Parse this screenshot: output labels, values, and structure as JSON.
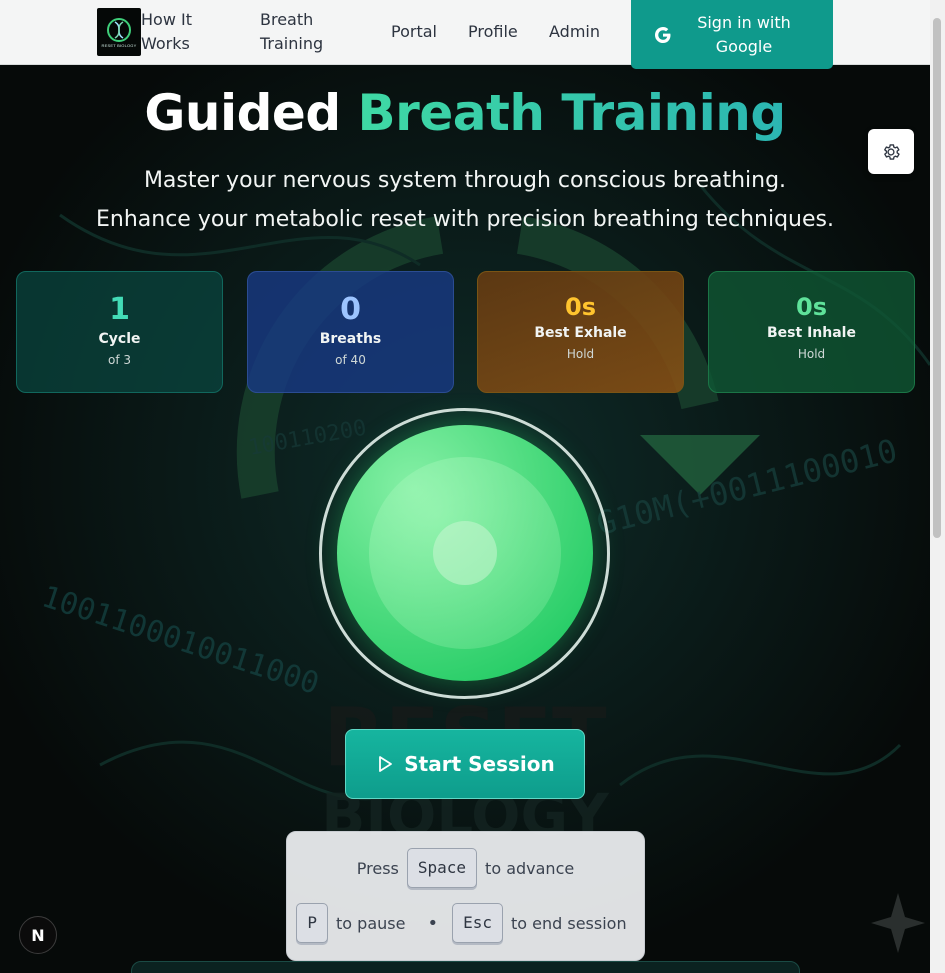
{
  "nav": {
    "logo_text": "RESET BIOLOGY",
    "links": [
      "How It Works",
      "Breath Training",
      "Portal",
      "Profile",
      "Admin"
    ],
    "signin_label": "Sign in with Google"
  },
  "hero": {
    "title_plain": "Guided",
    "title_accent": "Breath Training",
    "subtitle_1": "Master your nervous system through conscious breathing.",
    "subtitle_2": "Enhance your metabolic reset with precision breathing techniques."
  },
  "stats": [
    {
      "value": "1",
      "label": "Cycle",
      "sub": "of 3"
    },
    {
      "value": "0",
      "label": "Breaths",
      "sub": "of 40"
    },
    {
      "value": "0s",
      "label": "Best Exhale",
      "sub": "Hold"
    },
    {
      "value": "0s",
      "label": "Best Inhale",
      "sub": "Hold"
    }
  ],
  "start_button": {
    "label": "Start Session"
  },
  "shortcuts": {
    "press": "Press",
    "space_key": "Space",
    "advance": "to advance",
    "p_key": "P",
    "pause": "to pause",
    "separator": "•",
    "esc_key": "Esc",
    "end": "to end session"
  },
  "background_art": {
    "binary_left": "1001100010011000",
    "binary_right": "G10M(+0011100010",
    "binary_top": "100110200",
    "watermark_1": "RESET",
    "watermark_2": "BIOLOGY"
  },
  "badge": {
    "letter": "N"
  },
  "colors": {
    "accent": "#0f9a8c",
    "cycle": "#43dbb6",
    "breaths": "#9cc4ff",
    "exhale": "#ffc42e",
    "inhale": "#5fe29a",
    "orb": "#12c55a"
  }
}
